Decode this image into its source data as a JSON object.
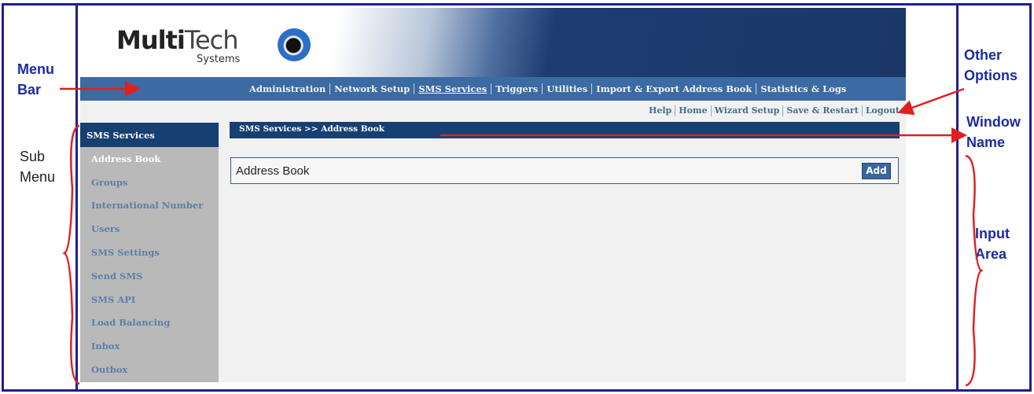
{
  "annotations": {
    "menu_bar": [
      "Menu",
      "Bar"
    ],
    "sub_menu": [
      "Sub",
      "Menu"
    ],
    "other_options": [
      "Other",
      "Options"
    ],
    "window_name": [
      "Window",
      "Name"
    ],
    "input_area": [
      "Input",
      "Area"
    ]
  },
  "logo": {
    "multi": "Multi",
    "tech": "Tech",
    "systems": "Systems"
  },
  "menubar": {
    "items": [
      "Administration",
      "Network Setup",
      "SMS Services",
      "Triggers",
      "Utilities",
      "Import & Export Address Book",
      "Statistics & Logs"
    ],
    "active": "SMS Services"
  },
  "options": [
    "Help",
    "Home",
    "Wizard Setup",
    "Save & Restart",
    "Logout"
  ],
  "sidebar": {
    "header": "SMS Services",
    "items": [
      "Address Book",
      "Groups",
      "International Number",
      "Users",
      "SMS Settings",
      "Send SMS",
      "SMS API",
      "Load Balancing",
      "Inbox",
      "Outbox"
    ],
    "active": "Address Book"
  },
  "window_title": "SMS Services >> Address Book",
  "panel": {
    "title": "Address Book",
    "add_label": "Add"
  },
  "colors": {
    "annotation": "#1c2ba0",
    "arrow": "#e02020",
    "navy": "#163f72",
    "menubar": "#3c6aa2"
  }
}
